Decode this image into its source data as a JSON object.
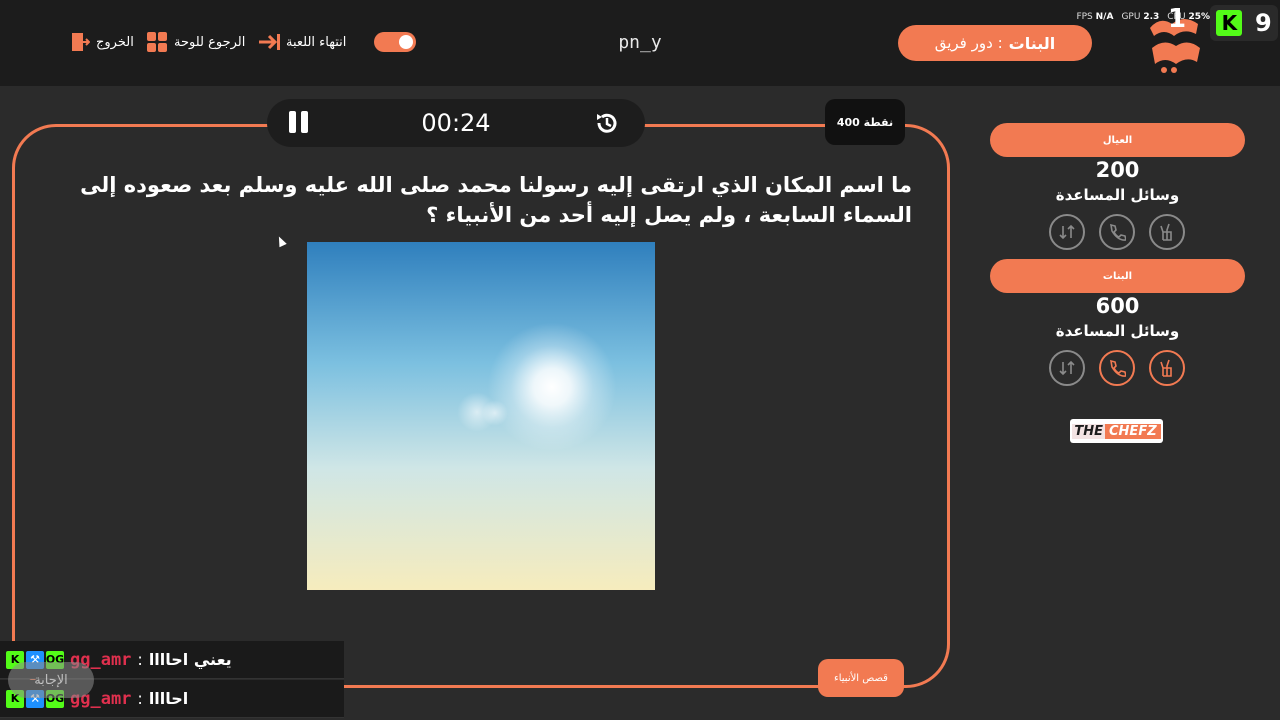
{
  "header": {
    "exit_label": "الخروج",
    "board_label": "الرجوع للوحة",
    "end_game_label": "انتهاء اللعبة",
    "username": "pn_y",
    "turn_prefix": "دور فريق :",
    "turn_team": "البنات",
    "hud": {
      "fps_label": "FPS",
      "fps_value": "N/A",
      "gpu_label": "GPU",
      "gpu_value": "2.3",
      "cpu_label": "CPU",
      "cpu_value": "25%"
    },
    "channel_count": "9",
    "viewer_rank": "1"
  },
  "timer": {
    "value": "00:24"
  },
  "points_label": "400 نقطة",
  "question": "ما اسم المكان الذي ارتقى إليه رسولنا محمد صلى الله عليه وسلم بعد صعوده إلى السماء السابعة ، ولم يصل إليه أحد من الأنبياء ؟",
  "category": "قصص الأنبياء",
  "teams": [
    {
      "name": "العيال",
      "score": "200",
      "aids_label": "وسائل المساعدة",
      "aids_active": [
        false,
        false,
        false
      ]
    },
    {
      "name": "البنات",
      "score": "600",
      "aids_label": "وسائل المساعدة",
      "aids_active": [
        true,
        true,
        false
      ]
    }
  ],
  "sponsor": {
    "part1": "THE",
    "part2": "CHEFZ"
  },
  "chat": [
    {
      "user": "gg_amr",
      "separator": ":",
      "message": "يعني احاااا"
    },
    {
      "user": "gg_amr",
      "separator": ":",
      "message": "احاااا"
    }
  ],
  "answer_button": "الإجابة",
  "colors": {
    "accent": "#f27a52",
    "background": "#2b2b2b",
    "topbar": "#1c1c1c"
  }
}
